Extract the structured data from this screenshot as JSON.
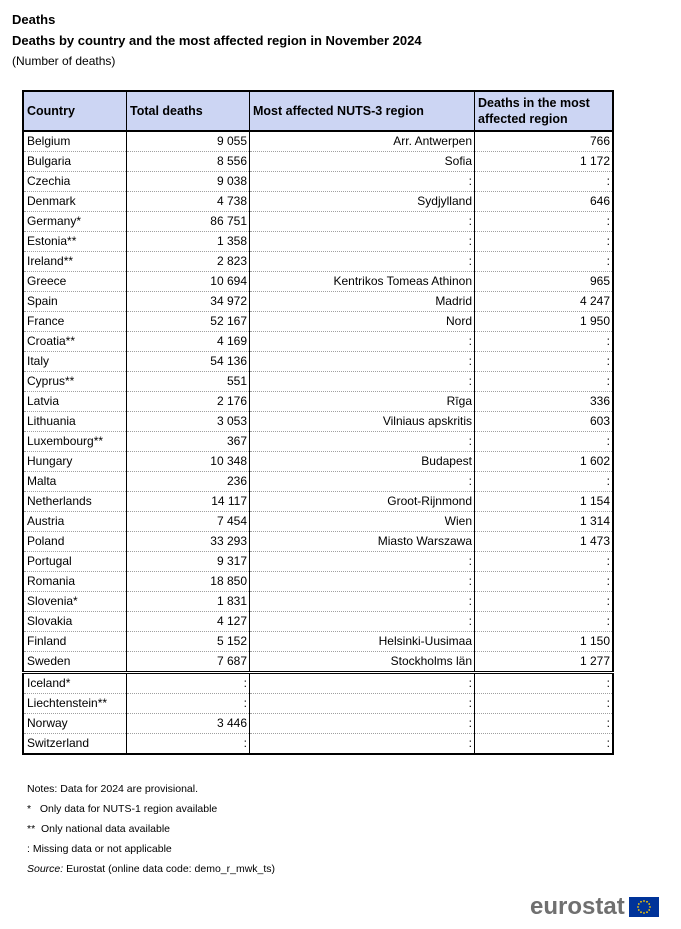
{
  "header": {
    "title": "Deaths",
    "subtitle": "Deaths by country and the most affected region in November 2024",
    "unit": "(Number of deaths)"
  },
  "table": {
    "columns": [
      "Country",
      "Total deaths",
      "Most affected NUTS-3 region",
      "Deaths in the most affected region"
    ],
    "rows": [
      {
        "country": "Belgium",
        "total": "9 055",
        "region": "Arr. Antwerpen",
        "region_deaths": "766"
      },
      {
        "country": "Bulgaria",
        "total": "8 556",
        "region": "Sofia",
        "region_deaths": "1 172"
      },
      {
        "country": "Czechia",
        "total": "9 038",
        "region": ":",
        "region_deaths": ":"
      },
      {
        "country": "Denmark",
        "total": "4 738",
        "region": "Sydjylland",
        "region_deaths": "646"
      },
      {
        "country": "Germany*",
        "total": "86 751",
        "region": ":",
        "region_deaths": ":"
      },
      {
        "country": "Estonia**",
        "total": "1 358",
        "region": ":",
        "region_deaths": ":"
      },
      {
        "country": "Ireland**",
        "total": "2 823",
        "region": ":",
        "region_deaths": ":"
      },
      {
        "country": "Greece",
        "total": "10 694",
        "region": "Kentrikos Tomeas Athinon",
        "region_deaths": "965"
      },
      {
        "country": "Spain",
        "total": "34 972",
        "region": "Madrid",
        "region_deaths": "4 247"
      },
      {
        "country": "France",
        "total": "52 167",
        "region": "Nord",
        "region_deaths": "1 950"
      },
      {
        "country": "Croatia**",
        "total": "4 169",
        "region": ":",
        "region_deaths": ":"
      },
      {
        "country": "Italy",
        "total": "54 136",
        "region": ":",
        "region_deaths": ":"
      },
      {
        "country": "Cyprus**",
        "total": "551",
        "region": ":",
        "region_deaths": ":"
      },
      {
        "country": "Latvia",
        "total": "2 176",
        "region": "Rīga",
        "region_deaths": "336"
      },
      {
        "country": "Lithuania",
        "total": "3 053",
        "region": "Vilniaus apskritis",
        "region_deaths": "603"
      },
      {
        "country": "Luxembourg**",
        "total": "367",
        "region": ":",
        "region_deaths": ":"
      },
      {
        "country": "Hungary",
        "total": "10 348",
        "region": "Budapest",
        "region_deaths": "1 602"
      },
      {
        "country": "Malta",
        "total": "236",
        "region": ":",
        "region_deaths": ":"
      },
      {
        "country": "Netherlands",
        "total": "14 117",
        "region": "Groot-Rijnmond",
        "region_deaths": "1 154"
      },
      {
        "country": "Austria",
        "total": "7 454",
        "region": "Wien",
        "region_deaths": "1 314"
      },
      {
        "country": "Poland",
        "total": "33 293",
        "region": "Miasto Warszawa",
        "region_deaths": "1 473"
      },
      {
        "country": "Portugal",
        "total": "9 317",
        "region": ":",
        "region_deaths": ":"
      },
      {
        "country": "Romania",
        "total": "18 850",
        "region": ":",
        "region_deaths": ":"
      },
      {
        "country": "Slovenia*",
        "total": "1 831",
        "region": ":",
        "region_deaths": ":"
      },
      {
        "country": "Slovakia",
        "total": "4 127",
        "region": ":",
        "region_deaths": ":"
      },
      {
        "country": "Finland",
        "total": "5 152",
        "region": "Helsinki-Uusimaa",
        "region_deaths": "1 150"
      },
      {
        "country": "Sweden",
        "total": "7 687",
        "region": "Stockholms län",
        "region_deaths": "1 277"
      },
      {
        "country": "Iceland*",
        "total": ":",
        "region": ":",
        "region_deaths": ":"
      },
      {
        "country": "Liechtenstein**",
        "total": ":",
        "region": ":",
        "region_deaths": ":"
      },
      {
        "country": "Norway",
        "total": "3 446",
        "region": ":",
        "region_deaths": ":"
      },
      {
        "country": "Switzerland",
        "total": ":",
        "region": ":",
        "region_deaths": ":"
      }
    ]
  },
  "notes": {
    "line1": "Notes: Data for 2024 are provisional.",
    "line2": "*   Only data for NUTS-1 region available",
    "line3": "**  Only national data available",
    "line4": ": Missing data or not applicable",
    "source_label": "Source:",
    "source_text": " Eurostat (online data code: demo_r_mwk_ts)"
  },
  "logo": {
    "text": "eurostat",
    "flag_color": "#003399",
    "star_color": "#ffcc00"
  },
  "colors": {
    "header_bg": "#ccd5f3"
  }
}
